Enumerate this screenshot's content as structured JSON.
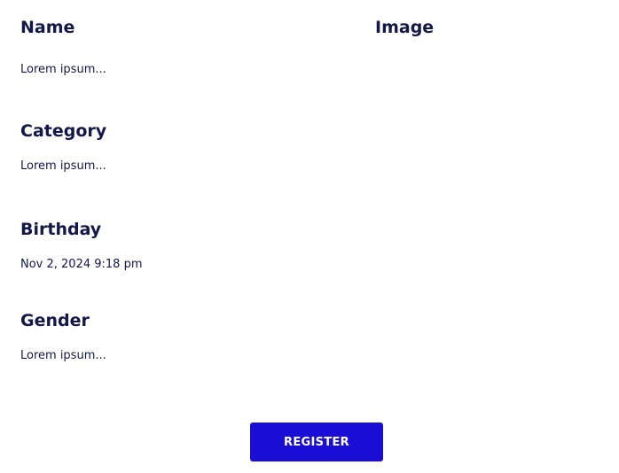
{
  "form": {
    "name": {
      "label": "Name",
      "value": "Lorem ipsum..."
    },
    "image": {
      "label": "Image"
    },
    "category": {
      "label": "Category",
      "value": "Lorem ipsum..."
    },
    "birthday": {
      "label": "Birthday",
      "value": "Nov 2, 2024 9:18 pm"
    },
    "gender": {
      "label": "Gender",
      "value": "Lorem ipsum..."
    }
  },
  "actions": {
    "register_label": "REGISTER"
  },
  "colors": {
    "label_text": "#13174a",
    "button_background": "#1a0dd6",
    "button_text": "#ffffff"
  }
}
